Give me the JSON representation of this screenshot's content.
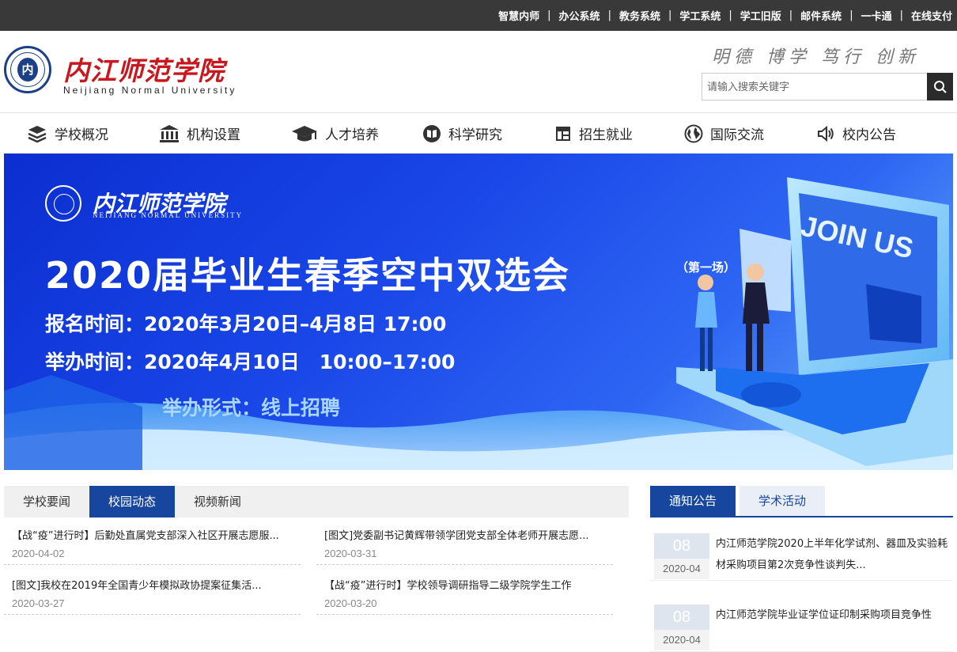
{
  "topbar": {
    "links": [
      "智慧内师",
      "办公系统",
      "教务系统",
      "学工系统",
      "学工旧版",
      "邮件系统",
      "一卡通",
      "在线支付"
    ]
  },
  "header": {
    "logo_seal_text": "内",
    "logo_cn": "内江师范学院",
    "logo_en": "Neijiang Normal University",
    "motto": "明德 博学 笃行 创新",
    "search_placeholder": "请输入搜索关键字"
  },
  "nav": {
    "items": [
      {
        "label": "学校概况",
        "icon": "layers-icon"
      },
      {
        "label": "机构设置",
        "icon": "building-icon"
      },
      {
        "label": "人才培养",
        "icon": "graduation-cap-icon"
      },
      {
        "label": "科学研究",
        "icon": "book-icon"
      },
      {
        "label": "招生就业",
        "icon": "table-icon"
      },
      {
        "label": "国际交流",
        "icon": "globe-icon"
      },
      {
        "label": "校内公告",
        "icon": "speaker-icon"
      }
    ]
  },
  "banner": {
    "logo_cn": "内江师范学院",
    "logo_en": "NEIJIANG NORMAL UNIVERSITY",
    "title": "2020届毕业生春季空中双选会",
    "sub": "（第一场）",
    "line1": "报名时间：2020年3月20日–4月8日 17:00",
    "line2": "举办时间：2020年4月10日　10:00–17:00",
    "form": "举办形式：线上招聘",
    "join_us": "JOIN US"
  },
  "news": {
    "tabs": [
      "学校要闻",
      "校园动态",
      "视频新闻"
    ],
    "active_tab": 1,
    "items": [
      {
        "title": "【战“疫”进行时】后勤处直属党支部深入社区开展志愿服...",
        "date": "2020-04-02"
      },
      {
        "title": "[图文]党委副书记黄辉带领学团党支部全体老师开展志愿...",
        "date": "2020-03-31"
      },
      {
        "title": "[图文]我校在2019年全国青少年模拟政协提案征集活...",
        "date": "2020-03-27"
      },
      {
        "title": "【战“疫”进行时】学校领导调研指导二级学院学生工作",
        "date": "2020-03-20"
      }
    ]
  },
  "notice": {
    "tabs": [
      "通知公告",
      "学术活动"
    ],
    "active_tab": 0,
    "items": [
      {
        "day": "08",
        "ym": "2020-04",
        "text": "内江师范学院2020上半年化学试剂、器皿及实验耗材采购项目第2次竞争性谈判失..."
      },
      {
        "day": "08",
        "ym": "2020-04",
        "text": "内江师范学院毕业证学位证印制采购项目竞争性"
      }
    ]
  }
}
